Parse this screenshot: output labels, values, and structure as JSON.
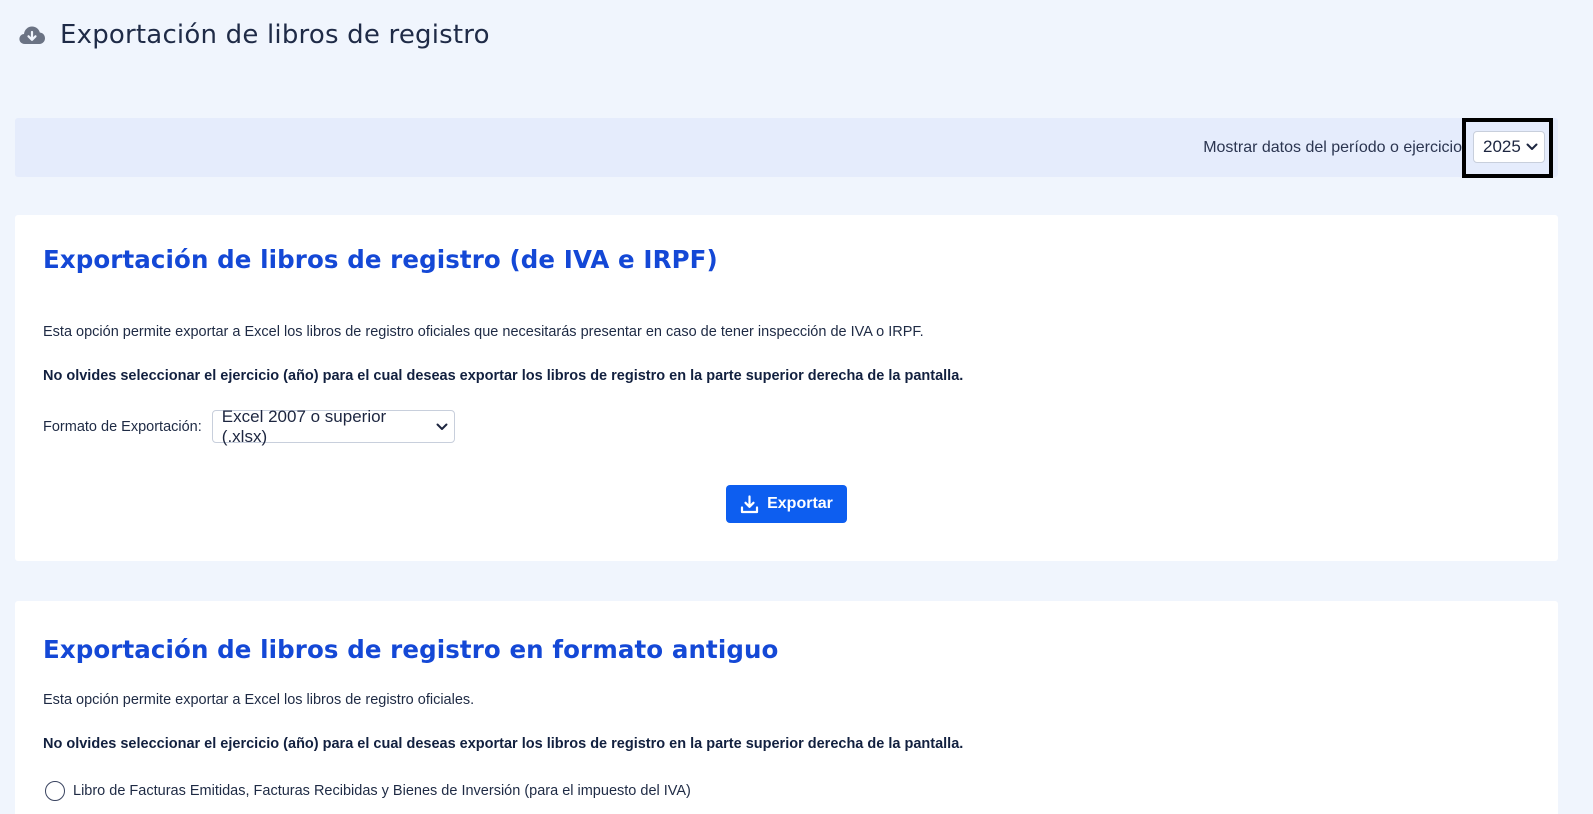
{
  "header": {
    "icon": "cloud-download-icon",
    "title": "Exportación de libros de registro"
  },
  "period": {
    "label": "Mostrar datos del período o ejercicio",
    "selected_year": "2025"
  },
  "section_iva_irpf": {
    "title": "Exportación de libros de registro (de IVA e IRPF)",
    "description": "Esta opción permite exportar a Excel los libros de registro oficiales que necesitarás presentar en caso de tener inspección de IVA o IRPF.",
    "reminder": "No olvides seleccionar el ejercicio (año) para el cual deseas exportar los libros de registro en la parte superior derecha de la pantalla.",
    "format_label": "Formato de Exportación:",
    "format_selected": "Excel 2007 o superior (.xlsx)",
    "export_label": "Exportar"
  },
  "section_old_format": {
    "title": "Exportación de libros de registro en formato antiguo",
    "description": "Esta opción permite exportar a Excel los libros de registro oficiales.",
    "reminder": "No olvides seleccionar el ejercicio (año) para el cual deseas exportar los libros de registro en la parte superior derecha de la pantalla.",
    "options": [
      {
        "label": "Libro de Facturas Emitidas, Facturas Recibidas y Bienes de Inversión (para el impuesto del IVA)",
        "checked": false
      }
    ]
  },
  "colors": {
    "background": "#f0f5fd",
    "period_bar": "#e5ecfc",
    "accent_title": "#1448d6",
    "button": "#0d5ef0"
  }
}
